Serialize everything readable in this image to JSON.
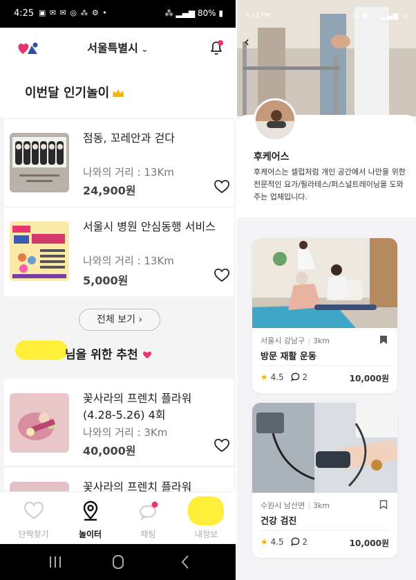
{
  "left": {
    "status": {
      "time": "4:25",
      "battery": "80%"
    },
    "header": {
      "city": "서울특별시",
      "city_chevron": "⌄"
    },
    "popular": {
      "title": "이번달 인기놀이",
      "items": [
        {
          "title": "점동, 꼬레안과 걷다",
          "distance": "나와의 거리 : 13Km",
          "price": "24,900원"
        },
        {
          "title": "서울시 병원 안심동행 서비스",
          "distance": "나와의 거리 : 13Km",
          "price": "5,000원"
        }
      ],
      "see_all": "전체 보기 ›"
    },
    "recommend": {
      "title_suffix": "님을 위한 추천",
      "items": [
        {
          "title": "꽃사라의 프렌치 플라워 (4.28-5.26) 4회",
          "distance": "나와의 거리 : 3Km",
          "price": "40,000원"
        },
        {
          "title": "꽃사라의 프렌치 플라워",
          "distance": "",
          "price": ""
        }
      ]
    },
    "nav": [
      {
        "label": "단짝찾기",
        "icon": "heart-icon"
      },
      {
        "label": "놀이터",
        "icon": "location-pin-icon"
      },
      {
        "label": "채팅",
        "icon": "chat-icon"
      },
      {
        "label": "내정보",
        "icon": "profile-icon"
      }
    ]
  },
  "right": {
    "status": {
      "time": "5:13 PM"
    },
    "profile": {
      "name": "후케어스",
      "description": "후케어스는 셀럽처럼 개인 공간에서 나만을 위한 전문적인 요가/필라테스/퍼스널트레이닝을 도와주는 업체입니다."
    },
    "cards": [
      {
        "location": "서울시 강남구",
        "distance": "3km",
        "title": "방문 재활 운동",
        "rating": "4.5",
        "comments": "2",
        "price": "10,000원",
        "bookmarked": true
      },
      {
        "location": "수원시 남산면",
        "distance": "3km",
        "title": "건강 검진",
        "rating": "4.5",
        "comments": "2",
        "price": "10,000원",
        "bookmarked": false
      }
    ]
  },
  "colors": {
    "accent_pink": "#e8366f",
    "accent_blue": "#2e4da3",
    "star": "#f3b300",
    "highlight_yellow": "#ffef3a"
  }
}
